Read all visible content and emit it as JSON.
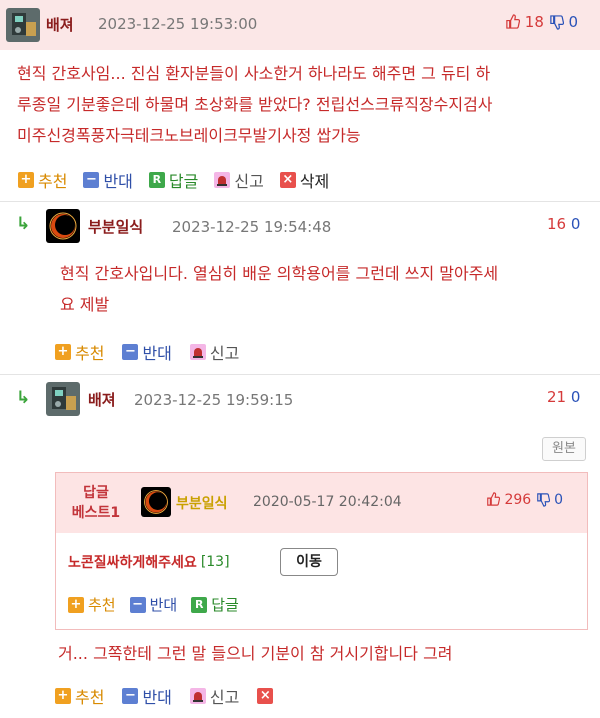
{
  "comments": [
    {
      "nick": "배져",
      "date": "2023-12-25 19:53:00",
      "up": "18",
      "down": "0",
      "lines": [
        "현직 간호사임... 진심 환자분들이 사소한거 하나라도 해주면 그 듀티 하",
        "루종일 기분좋은데 하물며 초상화를 받았다? 전립선스크류직장수지검사",
        "미주신경폭풍자극테크노브레이크무발기사정 쌉가능"
      ],
      "actions": {
        "up": "추천",
        "down": "반대",
        "reply": "답글",
        "report": "신고",
        "delete": "삭제"
      }
    },
    {
      "nick": "부분일식",
      "date": "2023-12-25 19:54:48",
      "up": "16",
      "down": "0",
      "lines": [
        "현직 간호사입니다. 열심히 배운 의학용어를 그런데 쓰지 말아주세",
        "요 제발"
      ],
      "actions": {
        "up": "추천",
        "down": "반대",
        "report": "신고"
      }
    },
    {
      "nick": "배져",
      "date": "2023-12-25 19:59:15",
      "up": "21",
      "down": "0",
      "origin_button": "원본",
      "best": {
        "label_line1": "답글",
        "label_line2": "베스트1",
        "nick": "부분일식",
        "date": "2020-05-17 20:42:04",
        "up": "296",
        "down": "0",
        "title": "노콘질싸하게해주세요",
        "count": "[13]",
        "move_button": "이동",
        "actions": {
          "up": "추천",
          "down": "반대",
          "reply": "답글"
        }
      },
      "lines": [
        "거... 그쪽한테 그런 말 들으니 기분이 참 거시기합니다 그려"
      ],
      "actions": {
        "up": "추천",
        "down": "반대",
        "report": "신고"
      }
    }
  ],
  "icons": {
    "thumb_up": "thumbs-up-icon",
    "thumb_down": "thumbs-down-icon",
    "reply_arrow": "reply-arrow-icon"
  },
  "colors": {
    "header_bg": "#fbe7e7",
    "body_text": "#c62a2a",
    "nick": "#8a1c1c",
    "vote_up": "#d53a3a",
    "vote_down": "#2a52b8"
  }
}
